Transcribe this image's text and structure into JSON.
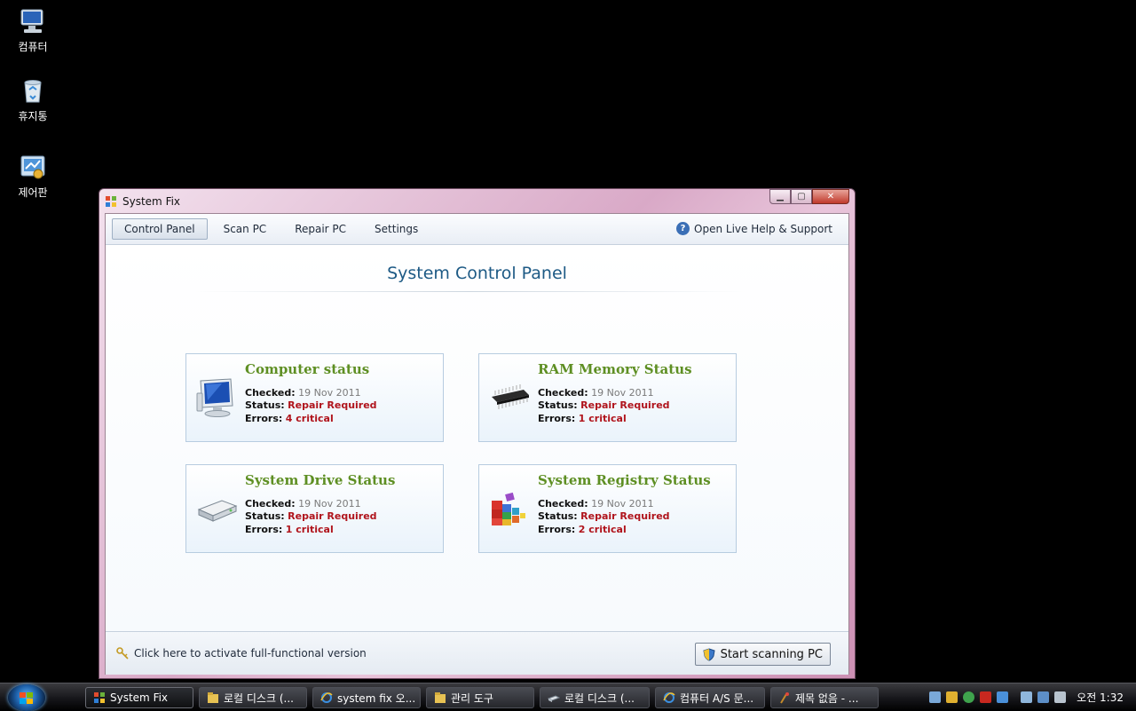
{
  "desktop": {
    "icons": [
      {
        "label": "컴퓨터",
        "icon": "computer-icon"
      },
      {
        "label": "휴지통",
        "icon": "recycle-bin-icon"
      },
      {
        "label": "제어판",
        "icon": "control-panel-icon"
      }
    ]
  },
  "window": {
    "title": "System Fix",
    "controls": {
      "minimize": "▁",
      "maximize": "▢",
      "close": "✕"
    }
  },
  "menu": {
    "items": [
      {
        "label": "Control Panel",
        "active": true
      },
      {
        "label": "Scan PC",
        "active": false
      },
      {
        "label": "Repair PC",
        "active": false
      },
      {
        "label": "Settings",
        "active": false
      }
    ],
    "help_label": "Open Live Help & Support",
    "help_icon": "?"
  },
  "page": {
    "title": "System Control Panel"
  },
  "labels": {
    "checked": "Checked:",
    "status": "Status:",
    "errors": "Errors:"
  },
  "cards": [
    {
      "title": "Computer status",
      "icon": "monitor-icon",
      "checked": "19 Nov 2011",
      "status": "Repair Required",
      "errors": "4 critical"
    },
    {
      "title": "RAM Memory Status",
      "icon": "ram-chip-icon",
      "checked": "19 Nov 2011",
      "status": "Repair Required",
      "errors": "1 critical"
    },
    {
      "title": "System Drive Status",
      "icon": "hard-drive-icon",
      "checked": "19 Nov 2011",
      "status": "Repair Required",
      "errors": "1 critical"
    },
    {
      "title": "System Registry Status",
      "icon": "registry-icon",
      "checked": "19 Nov 2011",
      "status": "Repair Required",
      "errors": "2 critical"
    }
  ],
  "footer": {
    "activate_label": "Click here to activate full-functional version",
    "scan_button_label": "Start scanning PC"
  },
  "taskbar": {
    "tasks": [
      {
        "label": "System Fix",
        "active": true
      },
      {
        "label": "로컬 디스크 (...",
        "active": false
      },
      {
        "label": "system fix 오...",
        "active": false
      },
      {
        "label": "관리 도구",
        "active": false
      },
      {
        "label": "로컬 디스크 (...",
        "active": false
      },
      {
        "label": "컴퓨터 A/S 문...",
        "active": false
      },
      {
        "label": "제목 없음 - ...",
        "active": false
      }
    ],
    "clock": "오전 1:32"
  },
  "colors": {
    "card_title": "#5e8f23",
    "status_red": "#b0141c",
    "page_title": "#1d5a85"
  }
}
